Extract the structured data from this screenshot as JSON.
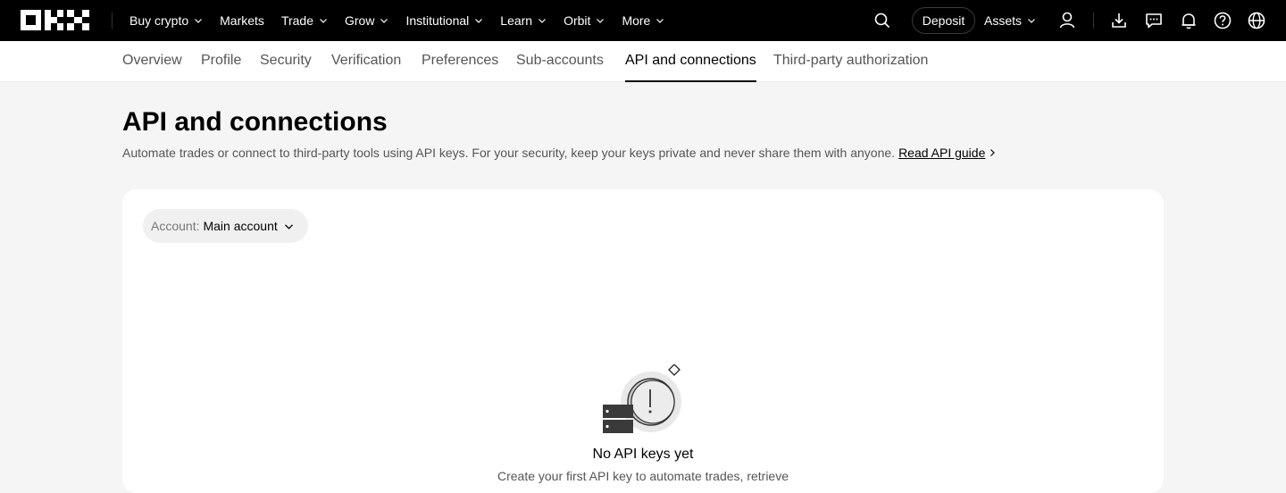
{
  "topnav": {
    "items": [
      {
        "label": "Buy crypto",
        "has_dropdown": true
      },
      {
        "label": "Markets",
        "has_dropdown": false
      },
      {
        "label": "Trade",
        "has_dropdown": true
      },
      {
        "label": "Grow",
        "has_dropdown": true
      },
      {
        "label": "Institutional",
        "has_dropdown": true
      },
      {
        "label": "Learn",
        "has_dropdown": true
      },
      {
        "label": "Orbit",
        "has_dropdown": true
      },
      {
        "label": "More",
        "has_dropdown": true
      }
    ],
    "deposit_label": "Deposit",
    "assets_label": "Assets",
    "icons": [
      "search-icon",
      "user-icon",
      "download-icon",
      "chat-icon",
      "bell-icon",
      "help-icon",
      "globe-icon"
    ]
  },
  "subnav": {
    "tabs": [
      {
        "label": "Overview"
      },
      {
        "label": "Profile"
      },
      {
        "label": "Security"
      },
      {
        "label": "Verification"
      },
      {
        "label": "Preferences"
      },
      {
        "label": "Sub-accounts"
      },
      {
        "label": "API and connections",
        "active": true
      },
      {
        "label": "Third-party authorization"
      }
    ]
  },
  "page": {
    "title": "API and connections",
    "subtitle": "Automate trades or connect to third-party tools using API keys. For your security, keep your keys private and never share them with anyone.",
    "guide_link": "Read API guide"
  },
  "card": {
    "account_label": "Account:",
    "account_value": "Main account",
    "empty_title": "No API keys yet",
    "empty_desc": "Create your first API key to automate trades, retrieve"
  },
  "colors": {
    "topbar_bg": "#000000",
    "page_bg": "#f5f5f5",
    "card_bg": "#ffffff",
    "muted_text": "#555555"
  }
}
